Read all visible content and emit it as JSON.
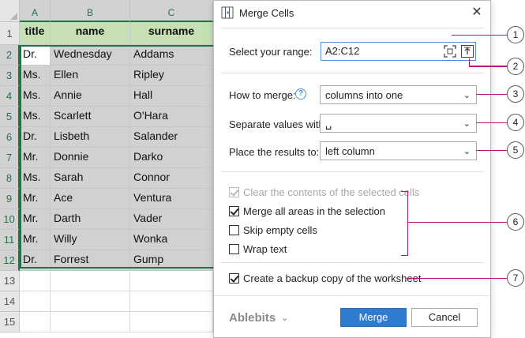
{
  "sheet": {
    "columns": [
      "A",
      "B",
      "C"
    ],
    "row_numbers": [
      "1",
      "2",
      "3",
      "4",
      "5",
      "6",
      "7",
      "8",
      "9",
      "10",
      "11",
      "12",
      "13",
      "14",
      "15"
    ],
    "header": [
      "title",
      "name",
      "surname"
    ],
    "rows": [
      [
        "Dr.",
        "Wednesday",
        "Addams"
      ],
      [
        "Ms.",
        "Ellen",
        "Ripley"
      ],
      [
        "Ms.",
        "Annie",
        "Hall"
      ],
      [
        "Ms.",
        "Scarlett",
        "O'Hara"
      ],
      [
        "Dr.",
        "Lisbeth",
        "Salander"
      ],
      [
        "Mr.",
        "Donnie",
        "Darko"
      ],
      [
        "Ms.",
        "Sarah",
        "Connor"
      ],
      [
        "Mr.",
        "Ace",
        "Ventura"
      ],
      [
        "Mr.",
        "Darth",
        "Vader"
      ],
      [
        "Mr.",
        "Willy",
        "Wonka"
      ],
      [
        "Dr.",
        "Forrest",
        "Gump"
      ]
    ],
    "selected_range": "A2:C12",
    "header_fill": "#c6e0b4",
    "selection_color": "#217346"
  },
  "dialog": {
    "title": "Merge Cells",
    "title_icon": "merge-cells-icon",
    "close_label": "✕",
    "range_label": "Select your range:",
    "range_value": "A2:C12",
    "how_label": "How to merge:",
    "how_value": "columns into one",
    "separator_label": "Separate values with:",
    "separator_value": "␣",
    "place_label": "Place the results to:",
    "place_value": "left column",
    "options": [
      {
        "label": "Clear the contents of the selected cells",
        "checked": true,
        "disabled": true
      },
      {
        "label": "Merge all areas in the selection",
        "checked": true,
        "disabled": false
      },
      {
        "label": "Skip empty cells",
        "checked": false,
        "disabled": false
      },
      {
        "label": "Wrap text",
        "checked": false,
        "disabled": false
      }
    ],
    "backup": {
      "label": "Create a backup copy of the worksheet",
      "checked": true
    },
    "brand": "Ablebits",
    "merge_button": "Merge",
    "cancel_button": "Cancel",
    "accent_color": "#2f7bd1"
  },
  "callouts": [
    "1",
    "2",
    "3",
    "4",
    "5",
    "6",
    "7"
  ]
}
